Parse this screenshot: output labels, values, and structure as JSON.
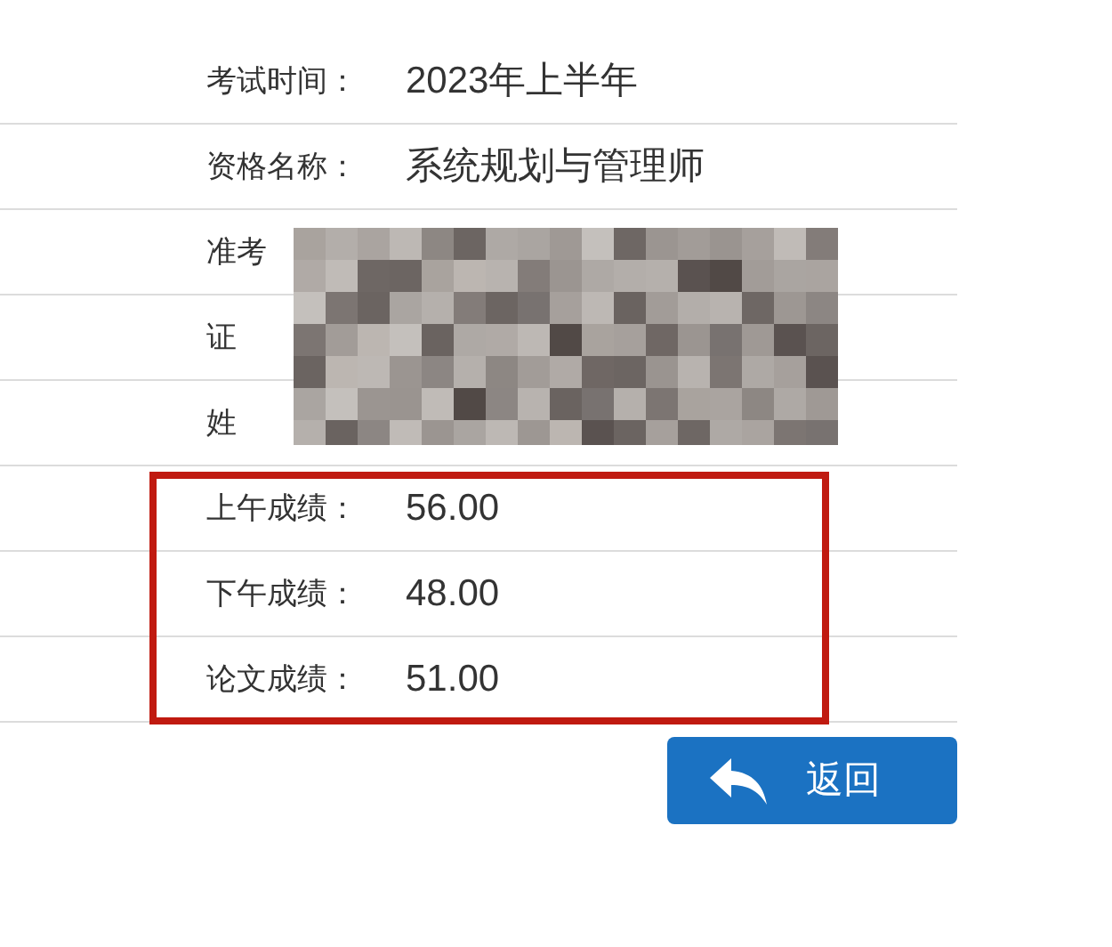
{
  "info_rows": [
    {
      "kind": "field",
      "label": "考试时间：",
      "value": "2023年上半年"
    },
    {
      "kind": "field",
      "label": "资格名称：",
      "value": "系统规划与管理师"
    },
    {
      "kind": "redacted",
      "label": "准考"
    },
    {
      "kind": "redacted",
      "label": "证"
    },
    {
      "kind": "redacted",
      "label": "姓"
    }
  ],
  "score_rows": [
    {
      "label": "上午成绩：",
      "value": "56.00"
    },
    {
      "label": "下午成绩：",
      "value": "48.00"
    },
    {
      "label": "论文成绩：",
      "value": "51.00"
    }
  ],
  "highlight_box": true,
  "back_button": {
    "label": "返回"
  }
}
